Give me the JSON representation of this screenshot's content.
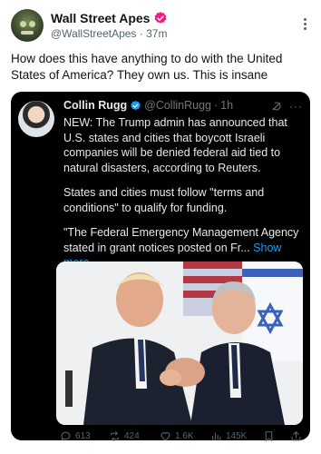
{
  "post": {
    "author_name": "Wall Street Apes",
    "handle": "@WallStreetApes",
    "separator": "·",
    "time": "37m",
    "text": "How does this have anything to do with the United States of America? They own us. This is insane"
  },
  "quoted": {
    "author_name": "Collin Rugg",
    "handle": "@CollinRugg",
    "separator": "·",
    "time": "1h",
    "more": "···",
    "paragraphs": [
      "NEW: The Trump admin has announced that U.S. states and cities that boycott Israeli companies will be denied federal aid tied to natural disasters, according to Reuters.",
      "States and cities must follow \"terms and conditions\" to qualify for funding.",
      "\"The Federal Emergency Management Agency stated in grant notices posted on Fr..."
    ],
    "show_more": "Show more"
  },
  "actions": {
    "replies": "613",
    "reposts": "424",
    "likes": "1.6K",
    "views": "145K"
  },
  "colors": {
    "verified_badge": "#f91880",
    "quote_bg": "#000000",
    "link": "#1d9bf0"
  }
}
